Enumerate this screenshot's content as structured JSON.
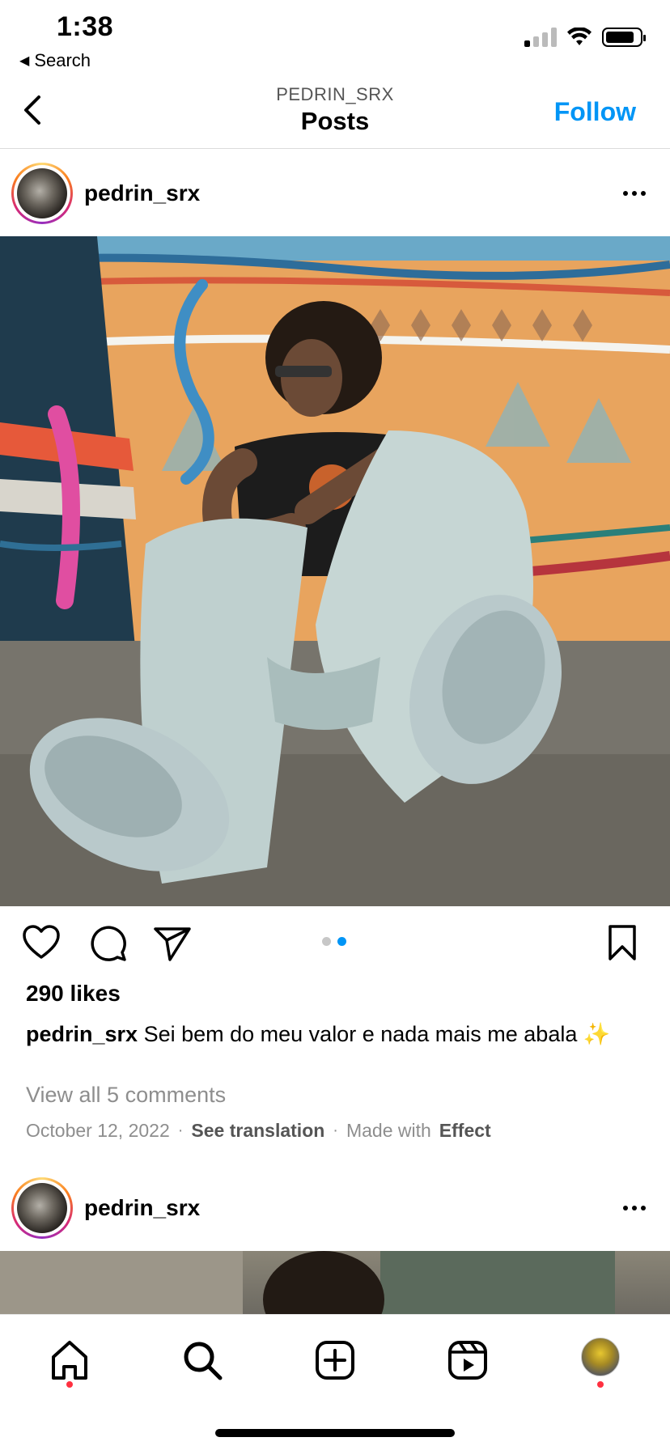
{
  "status_bar": {
    "time": "1:38",
    "back_label": "Search",
    "signal_icon": "cellular-signal-icon",
    "wifi_icon": "wifi-icon",
    "battery_icon": "battery-icon",
    "battery_level": 0.85
  },
  "nav": {
    "subtitle": "PEDRIN_SRX",
    "title": "Posts",
    "follow_label": "Follow",
    "back_icon": "chevron-left-icon"
  },
  "posts": [
    {
      "username": "pedrin_srx",
      "more_icon": "more-horizontal-icon",
      "carousel": {
        "count": 2,
        "active_index": 1
      },
      "likes": "290 likes",
      "caption_user": "pedrin_srx",
      "caption_text": " Sei bem do meu valor e nada mais me abala ✨",
      "view_comments": "View all 5 comments",
      "date": "October 12, 2022",
      "see_translation": "See translation",
      "made_with_prefix": "Made with",
      "made_with_effect": "Effect"
    },
    {
      "username": "pedrin_srx",
      "more_icon": "more-horizontal-icon"
    }
  ],
  "actions": {
    "like_icon": "heart-icon",
    "comment_icon": "comment-icon",
    "share_icon": "send-icon",
    "save_icon": "bookmark-icon"
  },
  "tab_bar": {
    "items": [
      "home-icon",
      "search-icon",
      "create-icon",
      "reels-icon",
      "profile-avatar"
    ],
    "notification_color": "#ff3040"
  },
  "colors": {
    "accent": "#0095f6",
    "muted": "#8e8e8e"
  }
}
